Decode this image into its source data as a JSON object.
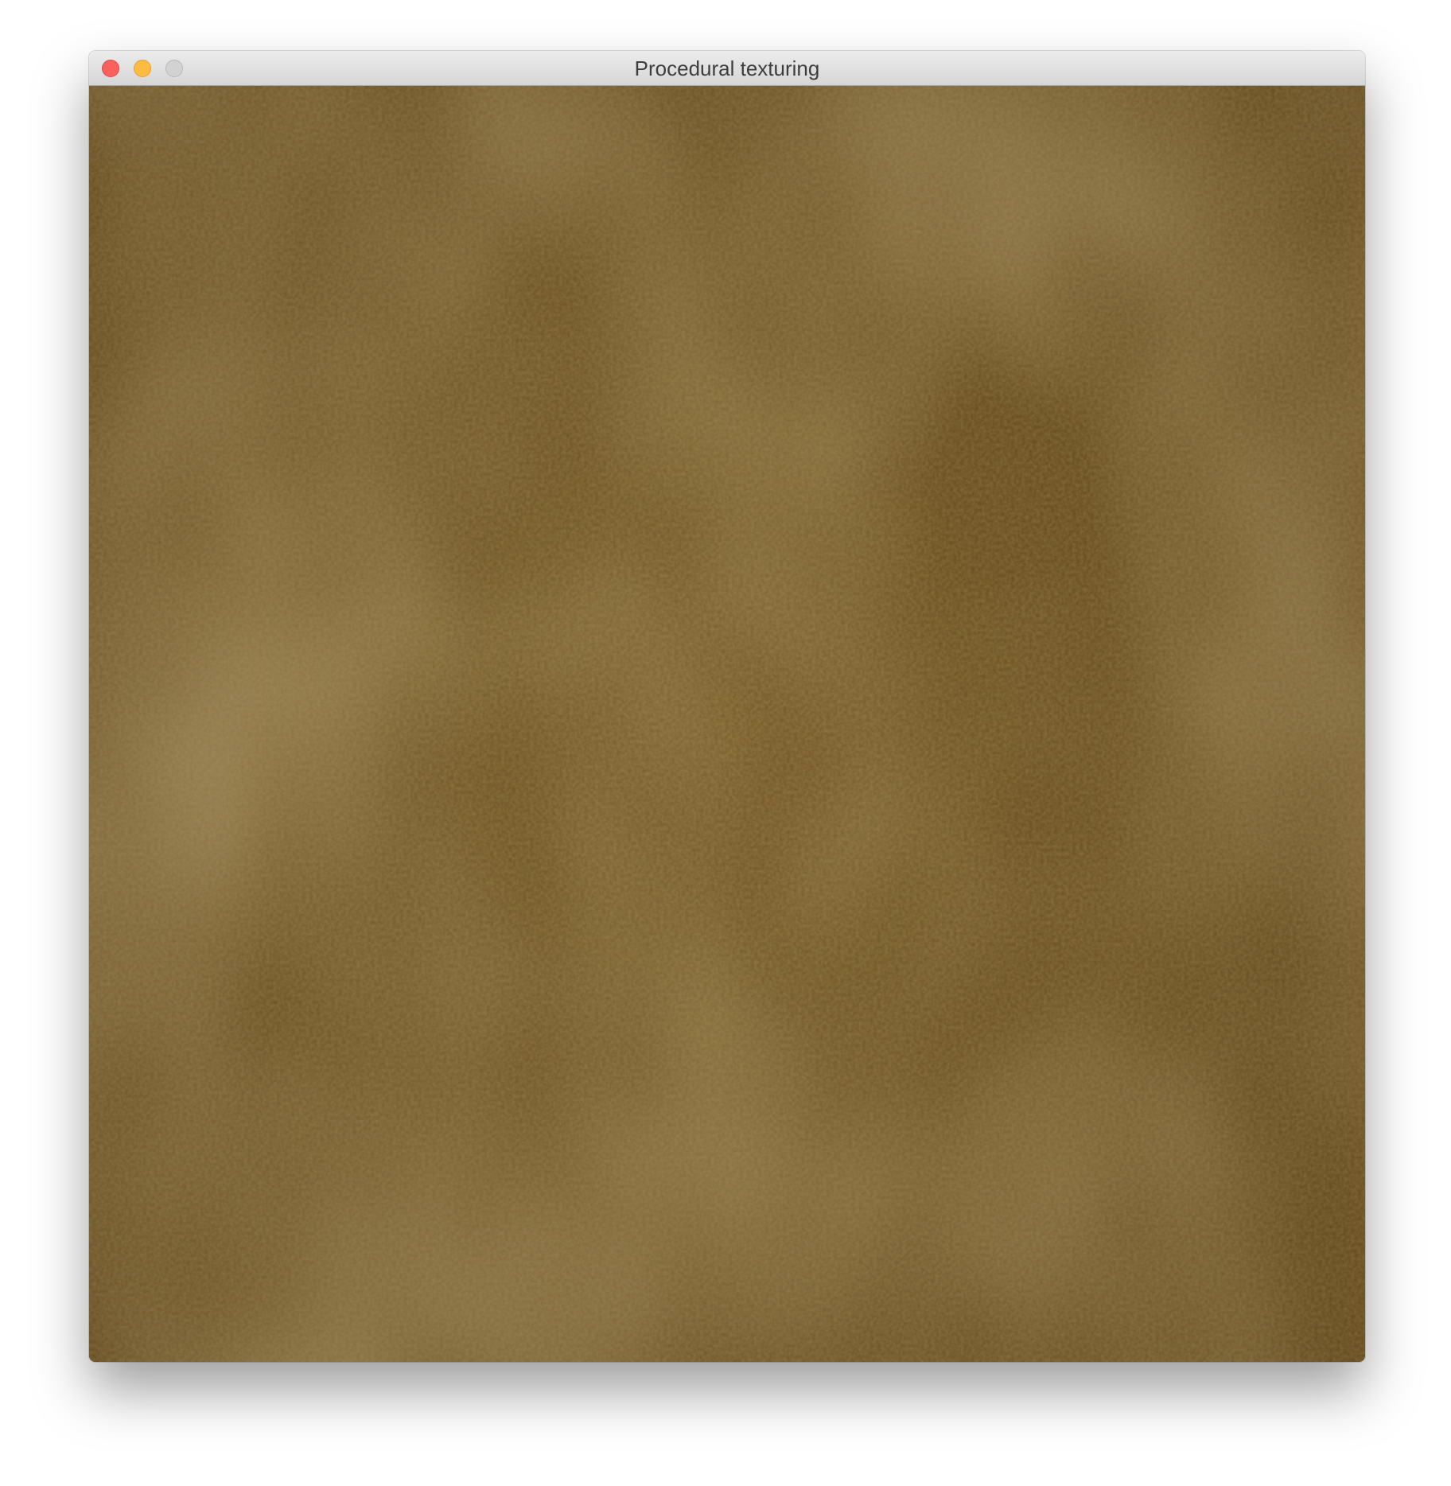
{
  "window": {
    "title": "Procedural texturing",
    "buttons": {
      "close": "close-button",
      "minimize": "minimize-button",
      "zoom": "zoom-button"
    }
  },
  "texture": {
    "base_color": "#6b4f1e",
    "light_color": "#8a6a33",
    "dark_color": "#4f3810"
  }
}
